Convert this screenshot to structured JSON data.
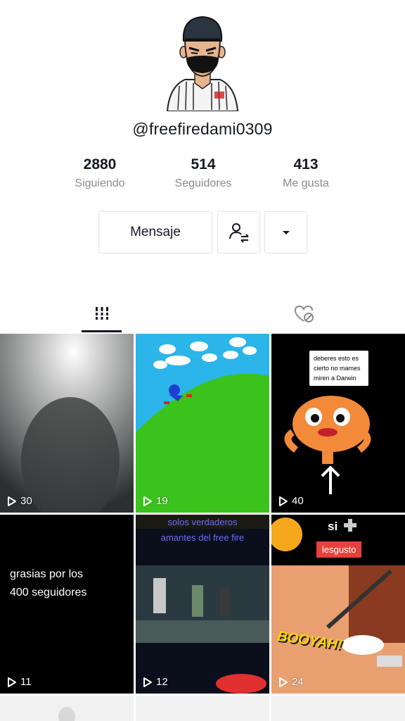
{
  "profile": {
    "username": "@freefiredami0309"
  },
  "stats": {
    "following": {
      "value": "2880",
      "label": "Siguiendo"
    },
    "followers": {
      "value": "514",
      "label": "Seguidores"
    },
    "likes": {
      "value": "413",
      "label": "Me gusta"
    }
  },
  "actions": {
    "message_label": "Mensaje",
    "follow_icon": "person-swap-icon",
    "more_icon": "caret-down-icon"
  },
  "tabs": {
    "videos_icon": "grid-icon",
    "liked_icon": "heart-hidden-icon"
  },
  "videos": [
    {
      "views": "30"
    },
    {
      "views": "19"
    },
    {
      "views": "40",
      "overlay_text": "deberes esto es cierto no mames miren a Darwin"
    },
    {
      "views": "11",
      "overlay_text_line1": "grasias por los",
      "overlay_text_line2": "400 seguidores"
    },
    {
      "views": "12",
      "overlay_text_line1": "solos verdaderos",
      "overlay_text_line2": "amantes del free fire"
    },
    {
      "views": "24",
      "overlay_text_top": "si",
      "badge_text": "lesgusto",
      "booyah_text": "BOOYAH!"
    }
  ],
  "colors": {
    "primary_text": "#161823",
    "secondary_text": "#8a8b91",
    "border": "#e3e3e4",
    "badge_red": "#e8413c"
  }
}
